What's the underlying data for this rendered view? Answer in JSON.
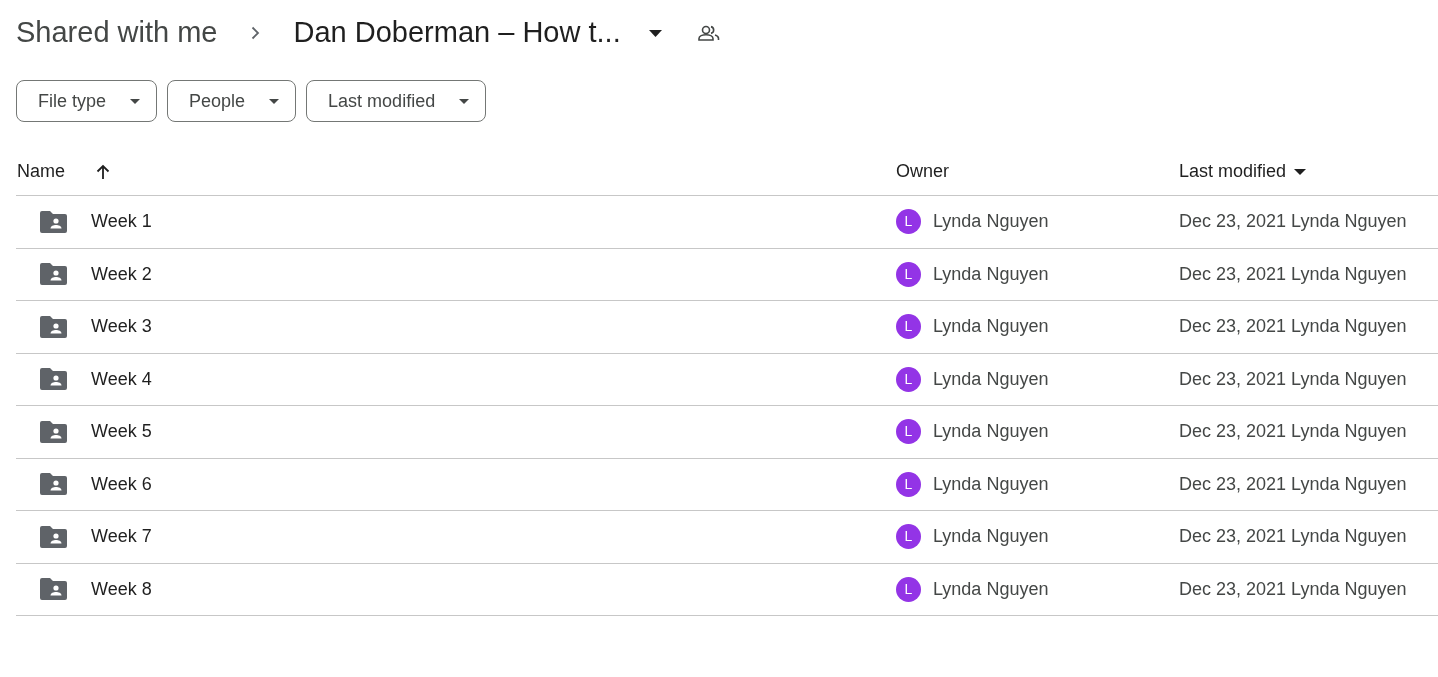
{
  "breadcrumb": {
    "parent": "Shared with me",
    "current": "Dan Doberman – How t..."
  },
  "filters": [
    {
      "label": "File type"
    },
    {
      "label": "People"
    },
    {
      "label": "Last modified"
    }
  ],
  "table": {
    "columns": [
      {
        "label": "Name",
        "sorted": true,
        "ascending": true
      },
      {
        "label": "Owner",
        "sorted": false
      },
      {
        "label": "Last modified",
        "sorted": true,
        "ascending": false
      }
    ],
    "rows": [
      {
        "name": "Week 1",
        "owner_initial": "L",
        "owner": "Lynda Nguyen",
        "modified": "Dec 23, 2021 Lynda Nguyen"
      },
      {
        "name": "Week 2",
        "owner_initial": "L",
        "owner": "Lynda Nguyen",
        "modified": "Dec 23, 2021 Lynda Nguyen"
      },
      {
        "name": "Week 3",
        "owner_initial": "L",
        "owner": "Lynda Nguyen",
        "modified": "Dec 23, 2021 Lynda Nguyen"
      },
      {
        "name": "Week 4",
        "owner_initial": "L",
        "owner": "Lynda Nguyen",
        "modified": "Dec 23, 2021 Lynda Nguyen"
      },
      {
        "name": "Week 5",
        "owner_initial": "L",
        "owner": "Lynda Nguyen",
        "modified": "Dec 23, 2021 Lynda Nguyen"
      },
      {
        "name": "Week 6",
        "owner_initial": "L",
        "owner": "Lynda Nguyen",
        "modified": "Dec 23, 2021 Lynda Nguyen"
      },
      {
        "name": "Week 7",
        "owner_initial": "L",
        "owner": "Lynda Nguyen",
        "modified": "Dec 23, 2021 Lynda Nguyen"
      },
      {
        "name": "Week 8",
        "owner_initial": "L",
        "owner": "Lynda Nguyen",
        "modified": "Dec 23, 2021 Lynda Nguyen"
      }
    ]
  }
}
